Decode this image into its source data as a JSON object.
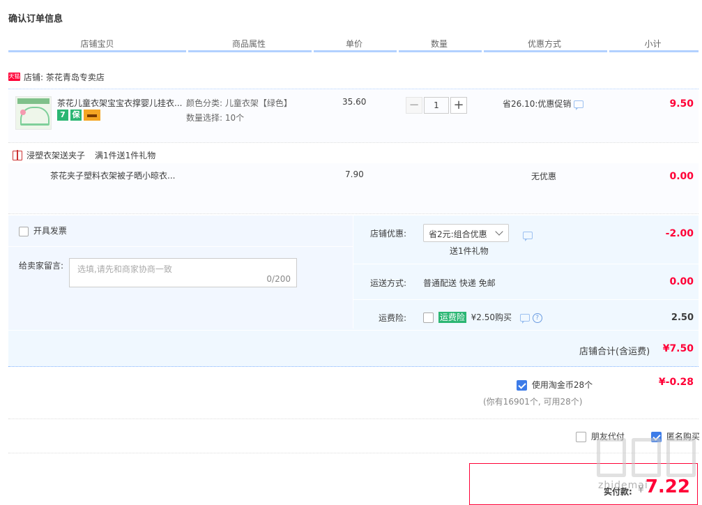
{
  "page_title": "确认订单信息",
  "table_headers": [
    "店铺宝贝",
    "商品属性",
    "单价",
    "数量",
    "优惠方式",
    "小计"
  ],
  "shop": {
    "badge": "天猫",
    "label": "店铺: 茶花青岛专卖店"
  },
  "item": {
    "title": "茶花儿童衣架宝宝衣撑婴儿挂衣...",
    "service_icons": [
      "7",
      "保",
      "card"
    ],
    "attr_color": "颜色分类: 儿童衣架【绿色】",
    "attr_qty": "数量选择: 10个",
    "price": "35.60",
    "quantity": "1",
    "minus": "−",
    "plus": "+",
    "promo": "省26.10:优惠促销",
    "subtotal": "9.50"
  },
  "gift": {
    "title": "浸塑衣架送夹子",
    "condition": "满1件送1件礼物",
    "item_title": "茶花夹子塑料衣架被子晒小晾衣...",
    "price": "7.90",
    "promo": "无优惠",
    "subtotal": "0.00"
  },
  "options": {
    "invoice_label": "开具发票",
    "memo_label": "给卖家留言:",
    "memo_placeholder": "选填,请先和商家协商一致",
    "memo_count": "0/200",
    "shop_discount_label": "店铺优惠:",
    "shop_discount_value": "省2元:组合优惠",
    "shop_discount_gift": "送1件礼物",
    "shop_discount_amount": "-2.00",
    "shipping_label": "运送方式:",
    "shipping_value": "普通配送 快递 免邮",
    "shipping_amount": "0.00",
    "insurance_label": "运费险:",
    "insurance_tag": "运费险",
    "insurance_price": "¥2.50购买",
    "insurance_amount": "2.50",
    "shop_total_label": "店铺合计(含运费)",
    "shop_total_amount": "¥7.50"
  },
  "coins": {
    "label": "使用淘金币28个",
    "amount": "¥-0.28",
    "note": "(你有16901个, 可用28个)"
  },
  "friend_pay_label": "朋友代付",
  "anonymous_label": "匿名购买",
  "payment": {
    "label": "实付款:",
    "currency": "¥",
    "amount": "7.22"
  },
  "watermark": "zhidemai",
  "colors": {
    "accent_red": "#ff0036",
    "header_line": "#b2d1ff",
    "option_bg": "#f0f8ff",
    "checkbox_blue": "#3d7ce8"
  }
}
